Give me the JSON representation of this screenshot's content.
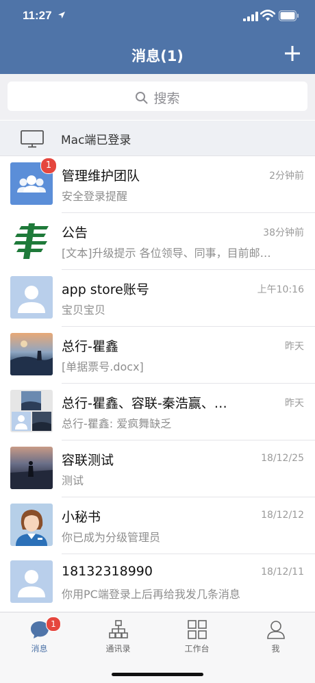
{
  "status_bar": {
    "time": "11:27"
  },
  "header": {
    "title": "消息(1)"
  },
  "search": {
    "placeholder": "搜索"
  },
  "mac_bar": {
    "text": "Mac端已登录"
  },
  "conversations": [
    {
      "name": "管理维护团队",
      "time": "2分钟前",
      "preview": "安全登录提醒",
      "badge": "1"
    },
    {
      "name": "公告",
      "time": "38分钟前",
      "preview": "[文本]升级提示 各位领导、同事，目前邮…"
    },
    {
      "name": "app store账号",
      "time": "上午10:16",
      "preview": "宝贝宝贝"
    },
    {
      "name": "总行-瞿鑫",
      "time": "昨天",
      "preview": "[单据票号.docx]"
    },
    {
      "name": "总行-瞿鑫、容联-秦浩赢、…",
      "time": "昨天",
      "preview": "总行-瞿鑫: 爱疯舞缺乏"
    },
    {
      "name": "容联测试",
      "time": "18/12/25",
      "preview": "测试"
    },
    {
      "name": "小秘书",
      "time": "18/12/12",
      "preview": "你已成为分级管理员"
    },
    {
      "name": "18132318990",
      "time": "18/12/11",
      "preview": "你用PC端登录上后再给我发几条消息"
    }
  ],
  "tabbar": {
    "tabs": [
      {
        "label": "消息",
        "icon": "chat-icon",
        "badge": "1",
        "active": true
      },
      {
        "label": "通讯录",
        "icon": "contacts-icon"
      },
      {
        "label": "工作台",
        "icon": "grid-icon"
      },
      {
        "label": "我",
        "icon": "person-icon"
      }
    ]
  },
  "colors": {
    "accent": "#4f74a8",
    "badge": "#e5463e"
  }
}
